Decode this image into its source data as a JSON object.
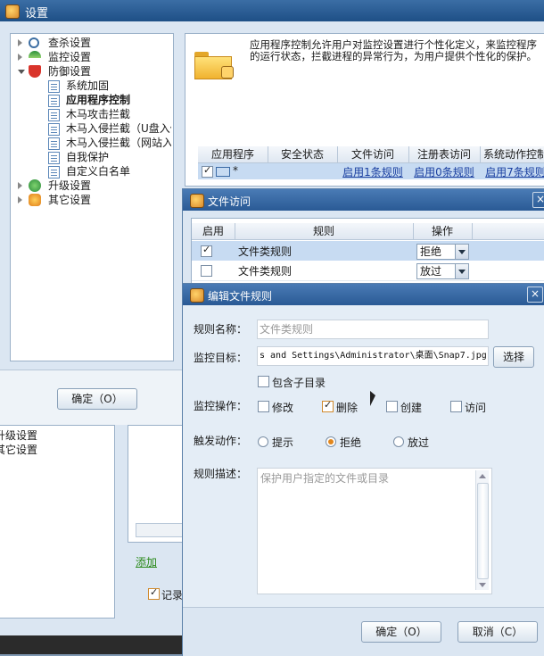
{
  "main_window": {
    "title": "设置"
  },
  "tree": [
    {
      "label": "查杀设置",
      "icon": "magnifier-icon"
    },
    {
      "label": "监控设置",
      "icon": "umbrella-icon"
    },
    {
      "label": "防御设置",
      "icon": "shield-icon"
    },
    {
      "label": "系统加固"
    },
    {
      "label": "应用程序控制"
    },
    {
      "label": "木马攻击拦截"
    },
    {
      "label": "木马入侵拦截（U盘入侵"
    },
    {
      "label": "木马入侵拦截（网站入侵"
    },
    {
      "label": "自我保护"
    },
    {
      "label": "自定义白名单"
    },
    {
      "label": "升级设置",
      "icon": "globe-icon"
    },
    {
      "label": "其它设置",
      "icon": "puzzle-icon"
    }
  ],
  "description": "应用程序控制允许用户对监控设置进行个性化定义，来监控程序的运行状态，拦截进程的异常行为，为用户提供个性化的保护。",
  "app_table": {
    "headers": [
      "应用程序",
      "安全状态",
      "文件访问",
      "注册表访问",
      "系统动作控制"
    ],
    "row": {
      "name": "*",
      "file": "启用1条规则",
      "registry": "启用0条规则",
      "system": "启用7条规则"
    }
  },
  "main_confirm": "确定（O）",
  "background": {
    "upgrade": "升级设置",
    "other": "其它设置",
    "add": "添加",
    "record": "记录"
  },
  "file_access_dialog": {
    "title": "文件访问",
    "headers": [
      "启用",
      "规则",
      "操作"
    ],
    "rows": [
      {
        "enabled": true,
        "rule": "文件类规则",
        "action": "拒绝"
      },
      {
        "enabled": false,
        "rule": "文件类规则",
        "action": "放过"
      }
    ]
  },
  "edit_dialog": {
    "title": "编辑文件规则",
    "rule_name_label": "规则名称：",
    "rule_name_placeholder": "文件类规则",
    "target_label": "监控目标：",
    "target_value": "s and Settings\\Administrator\\桌面\\Snap7.jpg",
    "select_button": "选择",
    "include_subdir": "包含子目录",
    "ops_label": "监控操作：",
    "ops": [
      {
        "label": "修改",
        "checked": false
      },
      {
        "label": "删除",
        "checked": true
      },
      {
        "label": "创建",
        "checked": false
      },
      {
        "label": "访问",
        "checked": false
      }
    ],
    "trigger_label": "触发动作：",
    "triggers": [
      {
        "label": "提示",
        "checked": false
      },
      {
        "label": "拒绝",
        "checked": true
      },
      {
        "label": "放过",
        "checked": false
      }
    ],
    "desc_label": "规则描述：",
    "desc_placeholder": "保护用户指定的文件或目录",
    "ok": "确定（O）",
    "cancel": "取消（C）"
  }
}
